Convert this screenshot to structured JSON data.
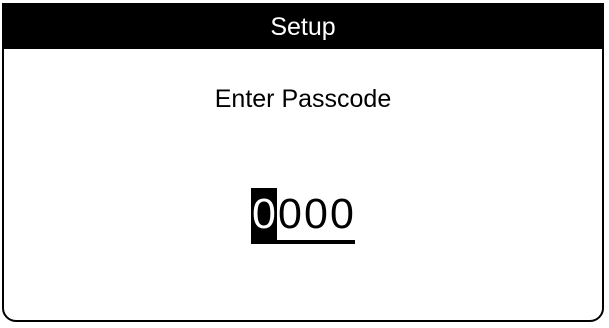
{
  "title": "Setup",
  "prompt": "Enter Passcode",
  "passcode": {
    "digits": [
      "0",
      "0",
      "0",
      "0"
    ],
    "selected_index": 0
  },
  "colors": {
    "foreground": "#000000",
    "background": "#ffffff"
  }
}
